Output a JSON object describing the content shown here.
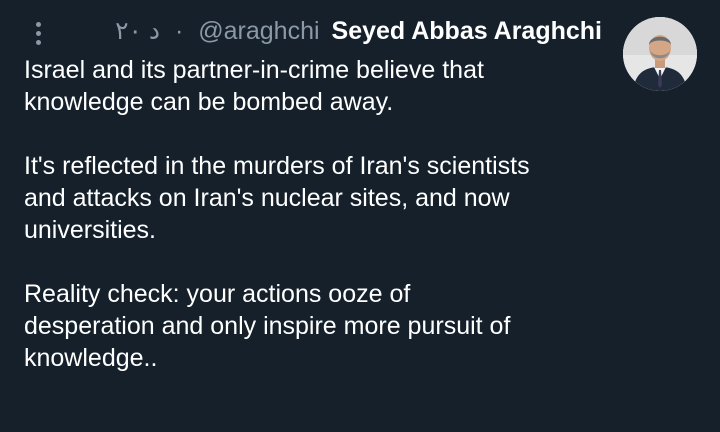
{
  "tweet": {
    "timestamp": "۲۰ د",
    "dot": "·",
    "handle": "@araghchi",
    "display_name": "Seyed Abbas Araghchi",
    "paragraphs": [
      {
        "lines": [
          "Israel and its partner-in-crime believe that",
          "knowledge can be bombed away."
        ]
      },
      {
        "lines": [
          "It's reflected in the murders of Iran's scientists",
          "and attacks on Iran's nuclear sites, and now",
          "universities."
        ]
      },
      {
        "lines": [
          "Reality check: your actions ooze of",
          "desperation and only inspire more pursuit of",
          "knowledge.."
        ]
      }
    ]
  },
  "icons": {
    "more": "more-vertical-icon"
  },
  "colors": {
    "background": "#15202b",
    "text": "#ffffff",
    "muted": "#8b98a5"
  }
}
